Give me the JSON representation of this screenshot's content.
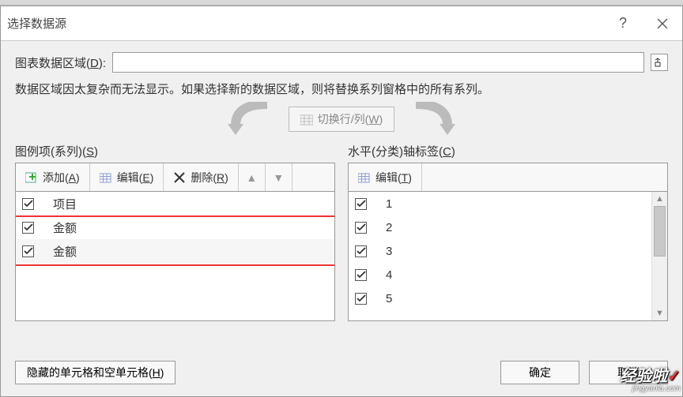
{
  "dialog": {
    "title": "选择数据源",
    "help": "?",
    "range": {
      "label_prefix": "图表数据区域(",
      "label_hotkey": "D",
      "label_suffix": "):",
      "value": ""
    },
    "info": "数据区域因太复杂而无法显示。如果选择新的数据区域，则将替换系列窗格中的所有系列。",
    "switch": {
      "prefix": "切换行/列(",
      "hotkey": "W",
      "suffix": ")"
    }
  },
  "left": {
    "header_prefix": "图例项(系列)(",
    "header_hotkey": "S",
    "header_suffix": ")",
    "add": {
      "prefix": "添加(",
      "hotkey": "A",
      "suffix": ")"
    },
    "edit": {
      "prefix": "编辑(",
      "hotkey": "E",
      "suffix": ")"
    },
    "remove": {
      "prefix": "删除(",
      "hotkey": "R",
      "suffix": ")"
    },
    "items": [
      {
        "label": "项目",
        "checked": true
      },
      {
        "label": "金额",
        "checked": true
      },
      {
        "label": "金额",
        "checked": true
      }
    ]
  },
  "right": {
    "header_prefix": "水平(分类)轴标签(",
    "header_hotkey": "C",
    "header_suffix": ")",
    "edit": {
      "prefix": "编辑(",
      "hotkey": "T",
      "suffix": ")"
    },
    "items": [
      {
        "label": "1",
        "checked": true
      },
      {
        "label": "2",
        "checked": true
      },
      {
        "label": "3",
        "checked": true
      },
      {
        "label": "4",
        "checked": true
      },
      {
        "label": "5",
        "checked": true
      }
    ]
  },
  "footer": {
    "hidden_prefix": "隐藏的单元格和空单元格(",
    "hidden_hotkey": "H",
    "hidden_suffix": ")",
    "ok": "确定",
    "cancel": "取消"
  },
  "watermark": {
    "line1": "经验啦",
    "line2": "jingyanla.com"
  }
}
